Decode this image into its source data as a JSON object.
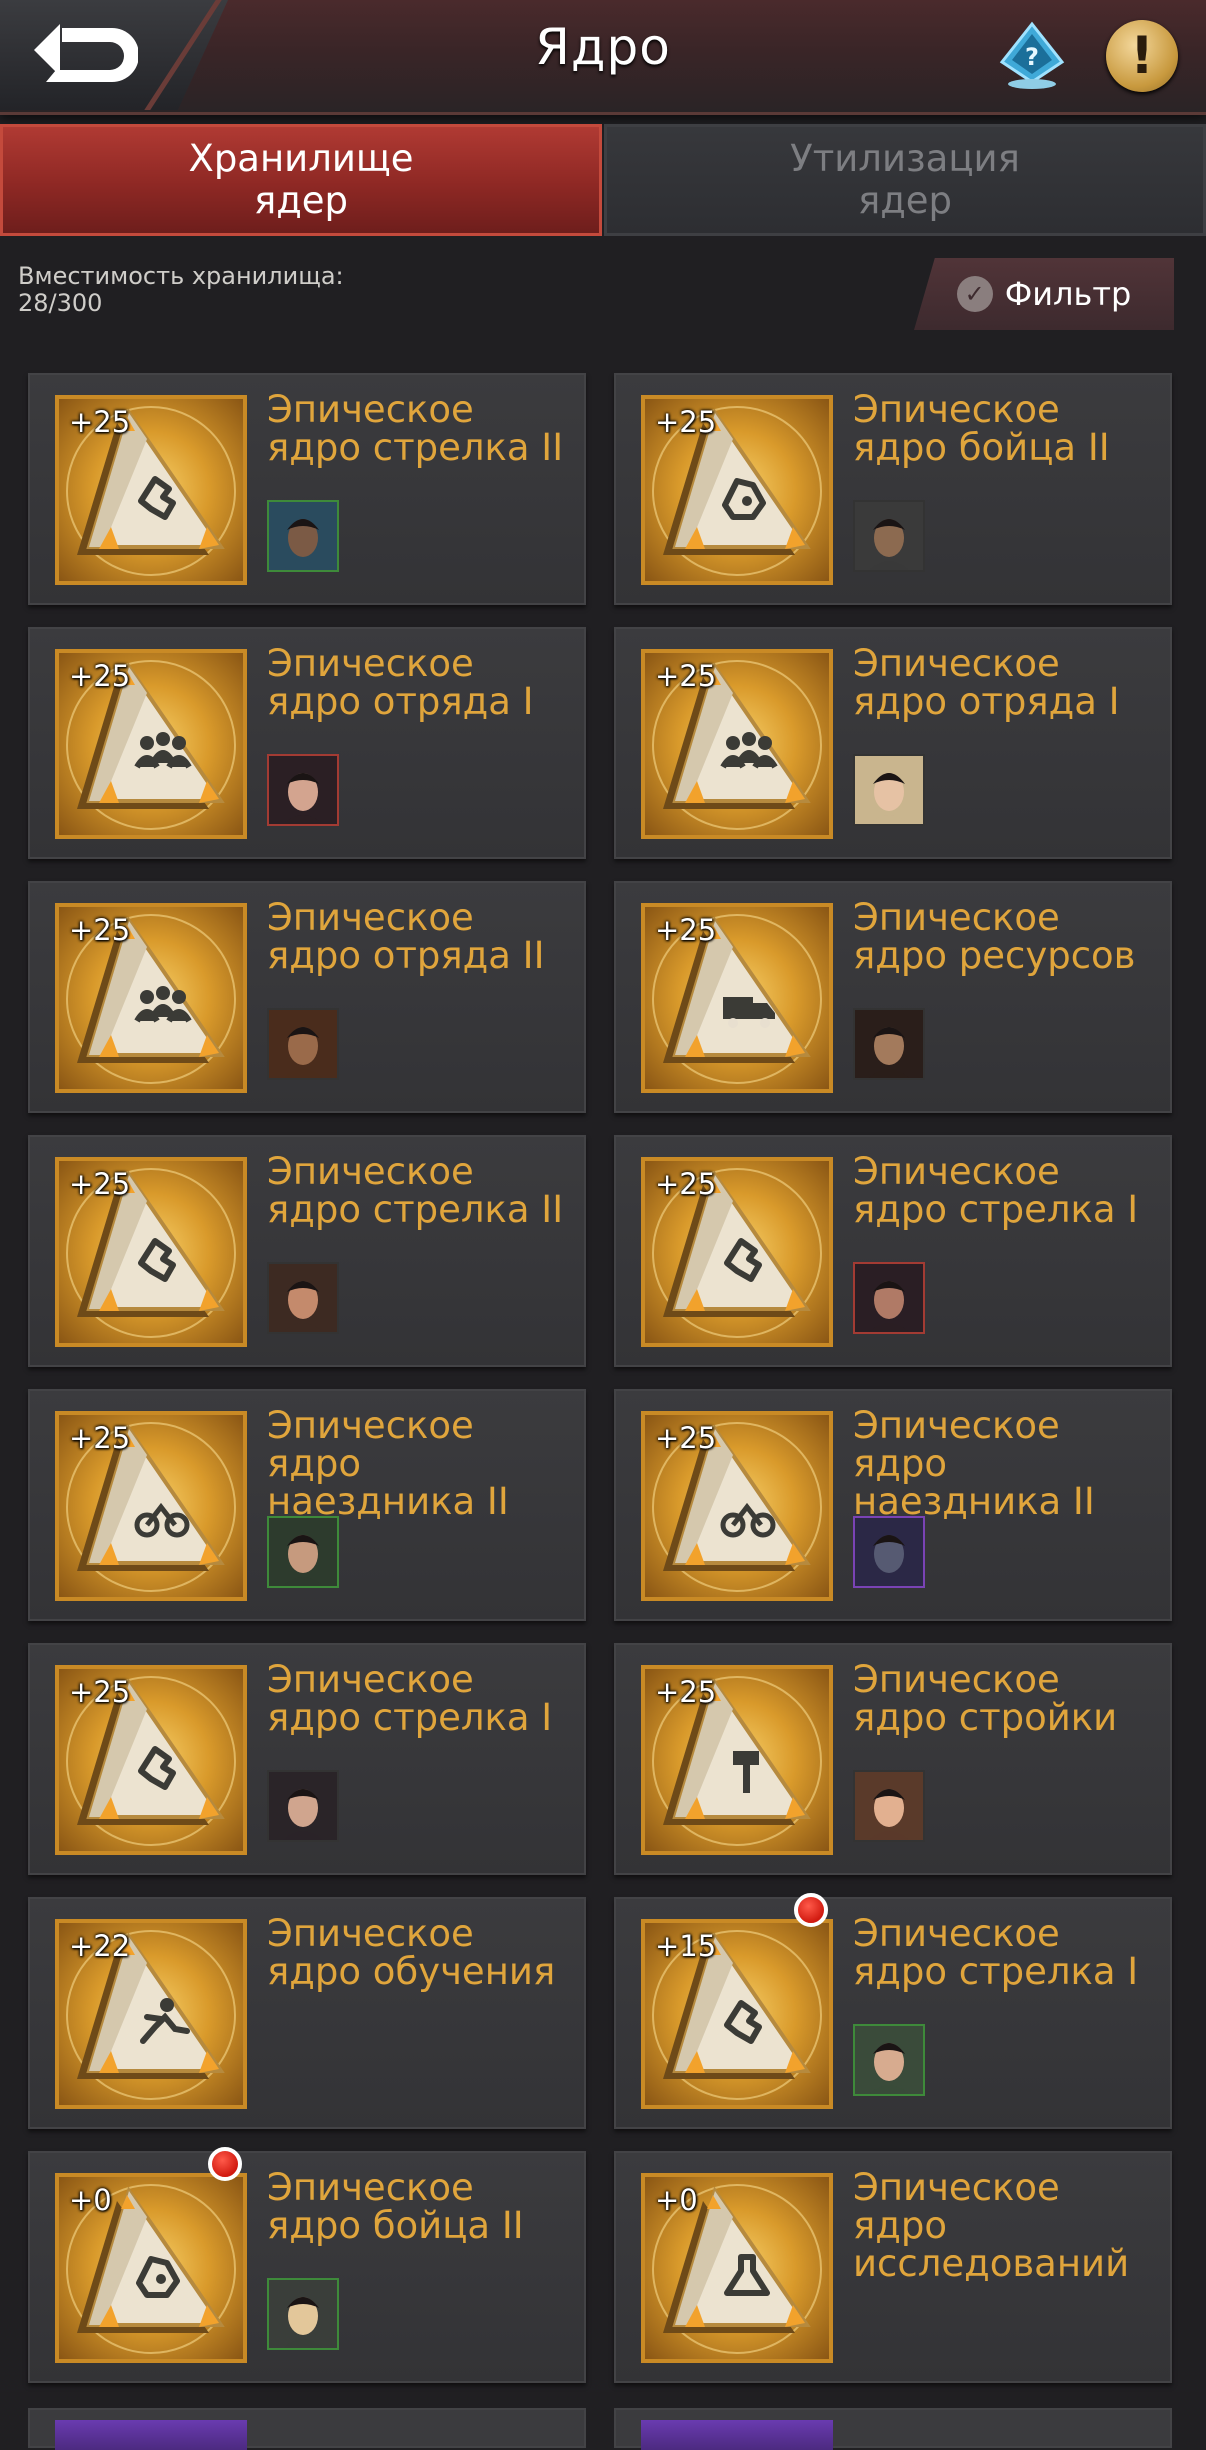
{
  "header": {
    "title": "Ядро",
    "back_icon": "back-arrow-icon",
    "help_icon": "question-hologram-icon",
    "info_icon": "exclamation-icon"
  },
  "tabs": [
    {
      "label": "Хранилище\nядер",
      "active": true
    },
    {
      "label": "Утилизация\nядер",
      "active": false
    }
  ],
  "storage": {
    "capacity_label": "Вместимость хранилища:",
    "capacity_value": "28/300",
    "filter_label": "Фильтр"
  },
  "cores": [
    {
      "level": "+25",
      "name": "Эпическое ядро стрелка II",
      "symbol": "shooter",
      "avatar": "green"
    },
    {
      "level": "+25",
      "name": "Эпическое ядро бойца II",
      "symbol": "fighter",
      "avatar": ""
    },
    {
      "level": "+25",
      "name": "Эпическое ядро отряда I",
      "symbol": "squad",
      "avatar": "red"
    },
    {
      "level": "+25",
      "name": "Эпическое ядро отряда I",
      "symbol": "squad",
      "avatar": ""
    },
    {
      "level": "+25",
      "name": "Эпическое ядро отряда II",
      "symbol": "squad",
      "avatar": ""
    },
    {
      "level": "+25",
      "name": "Эпическое ядро ресурсов",
      "symbol": "truck",
      "avatar": ""
    },
    {
      "level": "+25",
      "name": "Эпическое ядро стрелка II",
      "symbol": "shooter",
      "avatar": ""
    },
    {
      "level": "+25",
      "name": "Эпическое ядро стрелка I",
      "symbol": "shooter",
      "avatar": "red"
    },
    {
      "level": "+25",
      "name": "Эпическое ядро наездника II",
      "symbol": "rider",
      "avatar": "green"
    },
    {
      "level": "+25",
      "name": "Эпическое ядро наездника II",
      "symbol": "rider",
      "avatar": "purple"
    },
    {
      "level": "+25",
      "name": "Эпическое ядро стрелка I",
      "symbol": "shooter",
      "avatar": ""
    },
    {
      "level": "+25",
      "name": "Эпическое ядро стройки",
      "symbol": "hammer",
      "avatar": ""
    },
    {
      "level": "+22",
      "name": "Эпическое ядро обучения",
      "symbol": "runner",
      "avatar": null
    },
    {
      "level": "+15",
      "name": "Эпическое ядро стрелка I",
      "symbol": "shooter",
      "avatar": "green",
      "notification": true
    },
    {
      "level": "+0",
      "name": "Эпическое ядро бойца II",
      "symbol": "fighter",
      "avatar": "green",
      "notification": true
    },
    {
      "level": "+0",
      "name": "Эпическое ядро исследований",
      "symbol": "flask",
      "avatar": null
    }
  ],
  "avatar_palettes": [
    [
      "#2a4b5e",
      "#7b5a45"
    ],
    [
      "#3a3a3a",
      "#8c6a50"
    ],
    [
      "#2b1f24",
      "#d3a48f"
    ],
    [
      "#c9b58e",
      "#e6c2a4"
    ],
    [
      "#4a2c1c",
      "#9a6a4a"
    ],
    [
      "#2a1e1a",
      "#a37a5c"
    ],
    [
      "#3d2a22",
      "#c48a6c"
    ],
    [
      "#2a1e24",
      "#b07a66"
    ],
    [
      "#2d3b2d",
      "#c69a7e"
    ],
    [
      "#2b2846",
      "#565a72"
    ],
    [
      "#2a2428",
      "#d0a58e"
    ],
    [
      "#5a3a2a",
      "#e2b090"
    ],
    [
      "#000000",
      "#000000"
    ],
    [
      "#3a4b3a",
      "#d7ab8f"
    ],
    [
      "#3a3e3a",
      "#e3c79a"
    ],
    [
      "#000000",
      "#000000"
    ]
  ],
  "colors": {
    "accent_orange": "#e0a53c",
    "tab_active": "#9a2d28",
    "card_bg": "#38383b",
    "core_gold": "#d99a2b",
    "rare_purple": "#6a3bb0"
  }
}
